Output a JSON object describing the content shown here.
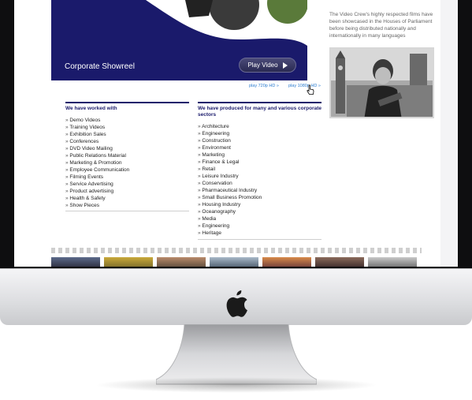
{
  "video": {
    "title": "Corporate Showreel",
    "play_label": "Play Video"
  },
  "hd_links": {
    "p720": "play 720p HD »",
    "p1080": "play 1080p HD »"
  },
  "worked_with": {
    "heading": "We have worked with",
    "items": [
      "Demo Videos",
      "Training Videos",
      "Exhibition Sales",
      "Conferences",
      "DVD Video Mailing",
      "Public Relations Material",
      "Marketing & Promotion",
      "Employee Communication",
      "Filming Events",
      "Service Advertising",
      "Product advertising",
      "Health & Safety",
      "Show Pieces"
    ]
  },
  "produced_for": {
    "heading": "We have produced for many and various corporate sectors",
    "items": [
      "Architecture",
      "Engineering",
      "Construction",
      "Environment",
      "Marketing",
      "Finance & Legal",
      "Retail",
      "Leisure Industry",
      "Conservation",
      "Pharmaceutical Industry",
      "Small Business Promotion",
      "Housing Industry",
      "Oceanography",
      "Media",
      "Engineering",
      "Heritage"
    ]
  },
  "sidebar": {
    "caption": "The Video Crew's highly respected films have been showcased in the Houses of Parliament before being distributed nationally and internationally in many languages"
  },
  "colors": {
    "navy": "#1a1a6b",
    "link": "#2a7bcf"
  },
  "icons": [
    "apple-logo-icon",
    "play-triangle-icon",
    "hand-cursor-icon"
  ]
}
